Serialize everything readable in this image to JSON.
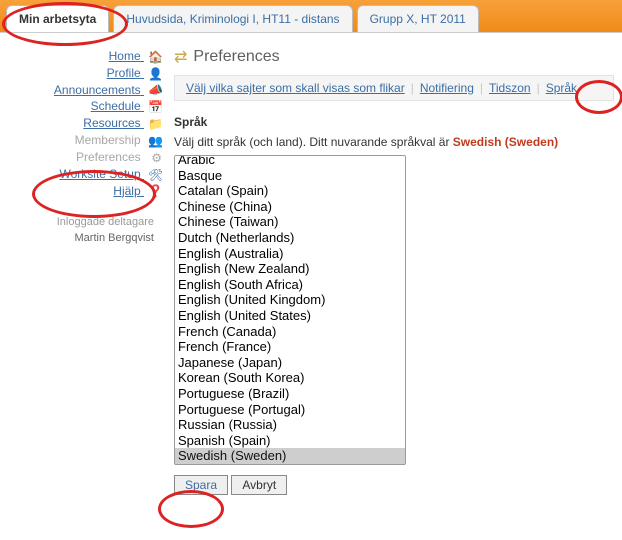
{
  "tabs": [
    {
      "label": "Min arbetsyta",
      "active": true
    },
    {
      "label": "Huvudsida, Kriminologi I, HT11 - distans",
      "active": false
    },
    {
      "label": "Grupp X, HT 2011",
      "active": false
    }
  ],
  "sidebar": {
    "items": [
      {
        "label": "Home",
        "name": "home"
      },
      {
        "label": "Profile",
        "name": "profile"
      },
      {
        "label": "Announcements",
        "name": "announcements"
      },
      {
        "label": "Schedule",
        "name": "schedule"
      },
      {
        "label": "Resources",
        "name": "resources"
      },
      {
        "label": "Membership",
        "name": "membership",
        "dim": true
      },
      {
        "label": "Preferences",
        "name": "preferences",
        "dim": true
      },
      {
        "label": "Worksite Setup",
        "name": "worksite-setup"
      }
    ],
    "help_label": "Hjälp",
    "logged_header": "Inloggade deltagare",
    "logged_user": "Martin Bergqvist"
  },
  "main": {
    "title": "Preferences",
    "subnav": [
      {
        "label": "Välj vilka sajter som skall visas som flikar"
      },
      {
        "label": "Notifiering"
      },
      {
        "label": "Tidszon"
      },
      {
        "label": "Språk"
      }
    ],
    "section_label": "Språk",
    "desc_prefix": "Välj ditt språk (och land). Ditt nuvarande språkval är ",
    "desc_current": "Swedish (Sweden)",
    "languages": [
      "Arabic",
      "Basque",
      "Catalan (Spain)",
      "Chinese (China)",
      "Chinese (Taiwan)",
      "Dutch (Netherlands)",
      "English (Australia)",
      "English (New Zealand)",
      "English (South Africa)",
      "English (United Kingdom)",
      "English (United States)",
      "French (Canada)",
      "French (France)",
      "Japanese (Japan)",
      "Korean (South Korea)",
      "Portuguese (Brazil)",
      "Portuguese (Portugal)",
      "Russian (Russia)",
      "Spanish (Spain)",
      "Swedish (Sweden)"
    ],
    "selected_language": "Swedish (Sweden)",
    "save_label": "Spara",
    "cancel_label": "Avbryt"
  }
}
